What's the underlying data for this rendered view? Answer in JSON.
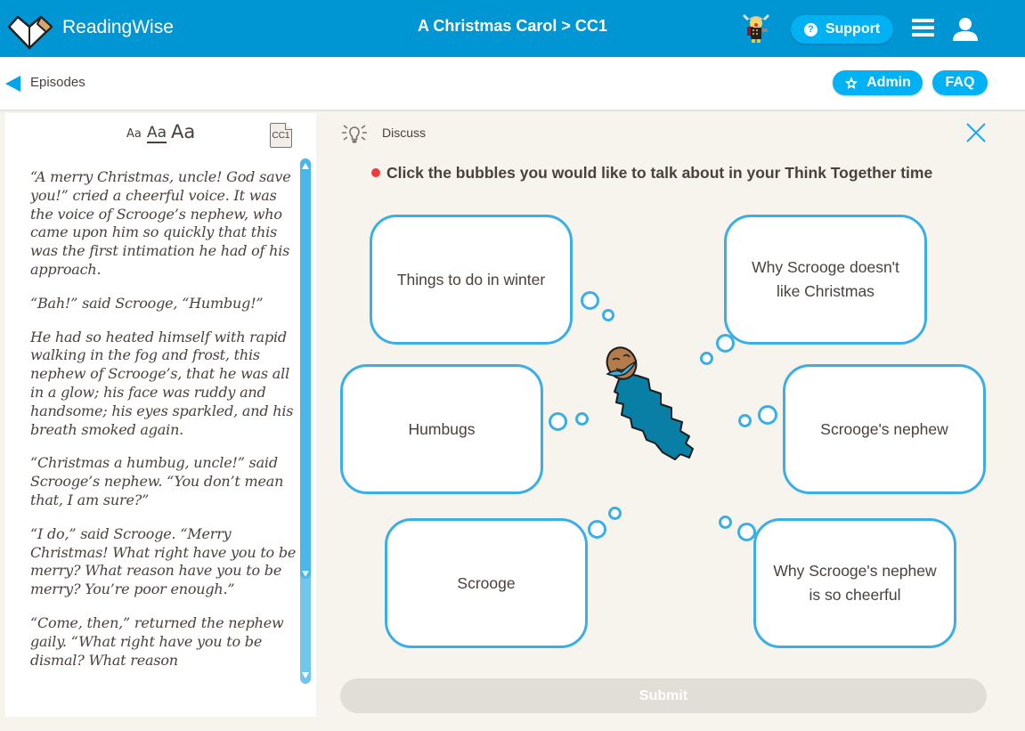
{
  "header": {
    "brand": "ReadingWise",
    "breadcrumb": "A Christmas Carol > CC1",
    "support_label": "Support",
    "colors": {
      "topbar": "#0096d3",
      "pill": "#00b2f3"
    }
  },
  "subbar": {
    "back_label": "Episodes",
    "admin_label": "Admin",
    "faq_label": "FAQ"
  },
  "reader": {
    "font_sizes": [
      "Aa",
      "Aa",
      "Aa"
    ],
    "selected_font_size": 1,
    "chapter_badge": "CC1",
    "paragraphs": [
      "“A merry Christmas, uncle! God save you!” cried a cheerful voice. It was the voice of Scrooge’s nephew, who came upon him so quickly that this was the first intimation he had of his approach.",
      "“Bah!” said Scrooge, “Humbug!”",
      "He had so heated himself with rapid walking in the fog and frost, this nephew of Scrooge’s, that he was all in a glow; his face was ruddy and handsome; his eyes sparkled, and his breath smoked again.",
      "“Christmas a humbug, uncle!” said Scrooge’s nephew. “You don’t mean that, I am sure?”",
      "“I do,” said Scrooge. “Merry Christmas! What right have you to be merry? What reason have you to be merry? You’re poor enough.”",
      "“Come, then,” returned the nephew gaily. “What right have you to be dismal? What reason"
    ]
  },
  "discuss": {
    "title": "Discuss",
    "instruction": "Click the bubbles you would like to talk about in your Think Together time",
    "bubbles": [
      {
        "label": "Things to do in winter"
      },
      {
        "label": "Why Scrooge doesn't like Christmas"
      },
      {
        "label": "Humbugs"
      },
      {
        "label": "Scrooge's nephew"
      },
      {
        "label": "Scrooge"
      },
      {
        "label": "Why Scrooge's nephew is so cheerful"
      }
    ],
    "submit_label": "Submit",
    "bubble_color": "#3aaee6",
    "indicator_color": "#ef3b3b"
  }
}
